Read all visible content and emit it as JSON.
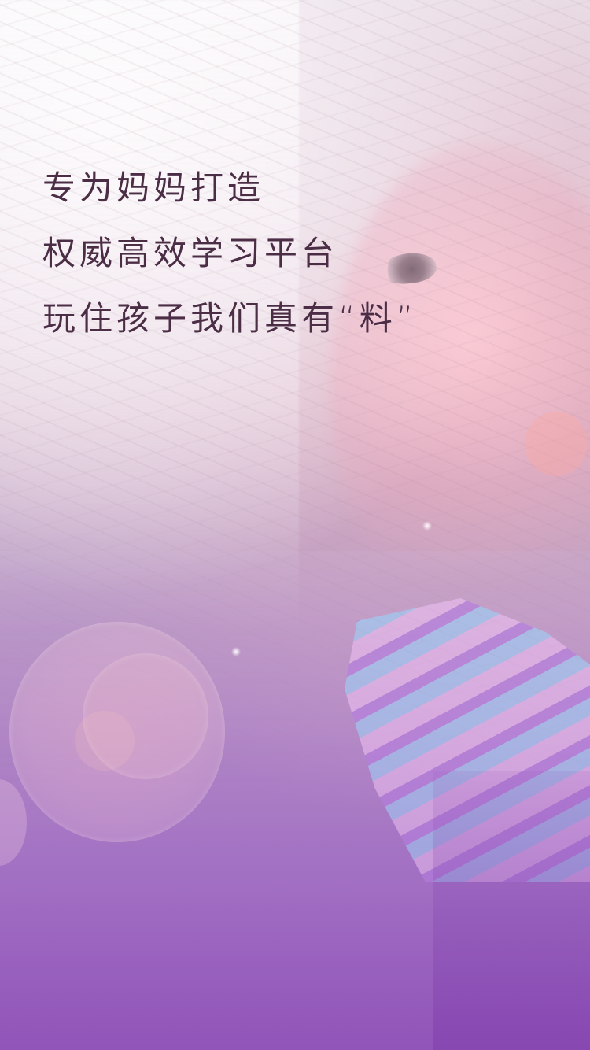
{
  "splash": {
    "lines": [
      "专为妈妈打造",
      "权威高效学习平台",
      "玩住孩子我们真有“料”"
    ]
  }
}
